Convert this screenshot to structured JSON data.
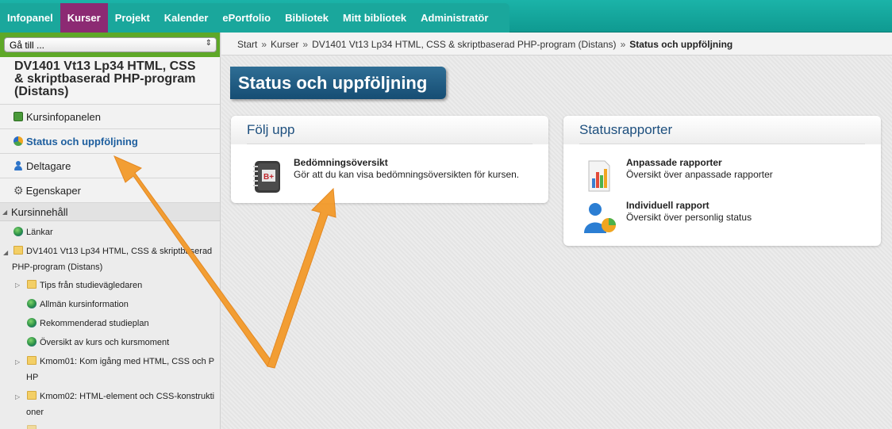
{
  "nav": {
    "items": [
      "Infopanel",
      "Kurser",
      "Projekt",
      "Kalender",
      "ePortfolio",
      "Bibliotek",
      "Mitt bibliotek",
      "Administratör"
    ],
    "active_index": 1
  },
  "sidebar": {
    "goto": "Gå till ...",
    "course_title": "DV1401 Vt13 Lp34 HTML, CSS & skriptbaserad PHP-program (Distans)",
    "items": [
      {
        "label": "Kursinfopanelen",
        "icon": "kursinfo-icon"
      },
      {
        "label": "Status och uppföljning",
        "icon": "status-icon",
        "active": true
      },
      {
        "label": "Deltagare",
        "icon": "person-icon"
      },
      {
        "label": "Egenskaper",
        "icon": "gear-icon"
      }
    ],
    "section": "Kursinnehåll",
    "tree": [
      "Länkar",
      "DV1401 Vt13 Lp34 HTML, CSS & skriptbaserad",
      "PHP-program (Distans)",
      "Tips från studievägledaren",
      "Allmän kursinformation",
      "Rekommenderad studieplan",
      "Översikt av kurs och kursmoment",
      "Kmom01: Kom igång med HTML, CSS och P",
      "HP",
      "Kmom02: HTML-element och CSS-konstrukti",
      "oner"
    ]
  },
  "breadcrumb": {
    "items": [
      "Start",
      "Kurser",
      "DV1401 Vt13 Lp34 HTML, CSS & skriptbaserad PHP-program (Distans)"
    ],
    "current": "Status och uppföljning",
    "separator": "»"
  },
  "page_title": "Status och uppföljning",
  "folj_upp": {
    "title": "Följ upp",
    "entry_title": "Bedömningsöversikt",
    "entry_desc": "Gör att du kan visa bedömningsöversikten för kursen.",
    "icon_text": "B+"
  },
  "statusrapporter": {
    "title": "Statusrapporter",
    "entries": [
      {
        "title": "Anpassade rapporter",
        "desc": "Översikt över anpassade rapporter"
      },
      {
        "title": "Individuell rapport",
        "desc": "Översikt över personlig status"
      }
    ]
  },
  "colors": {
    "nav": "#1aa79c",
    "nav_active": "#8c2a73",
    "title_bar": "#1f5a82",
    "arrow": "#f39a2a"
  }
}
